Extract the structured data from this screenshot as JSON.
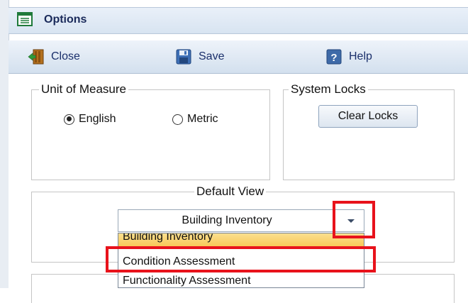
{
  "window": {
    "title": "Options",
    "accent_color": "#e8121b"
  },
  "toolbar": {
    "close_label": "Close",
    "save_label": "Save",
    "help_label": "Help"
  },
  "unit_of_measure": {
    "legend": "Unit of Measure",
    "options": [
      {
        "label": "English",
        "selected": true
      },
      {
        "label": "Metric",
        "selected": false
      }
    ]
  },
  "system_locks": {
    "legend": "System Locks",
    "clear_label": "Clear Locks"
  },
  "default_view": {
    "legend": "Default View",
    "selected": "Building Inventory",
    "options": [
      {
        "label": "Building Inventory",
        "highlighted": true
      },
      {
        "label": "Condition Assessment",
        "highlighted": false
      },
      {
        "label": "Functionality Assessment",
        "highlighted": false
      }
    ]
  }
}
